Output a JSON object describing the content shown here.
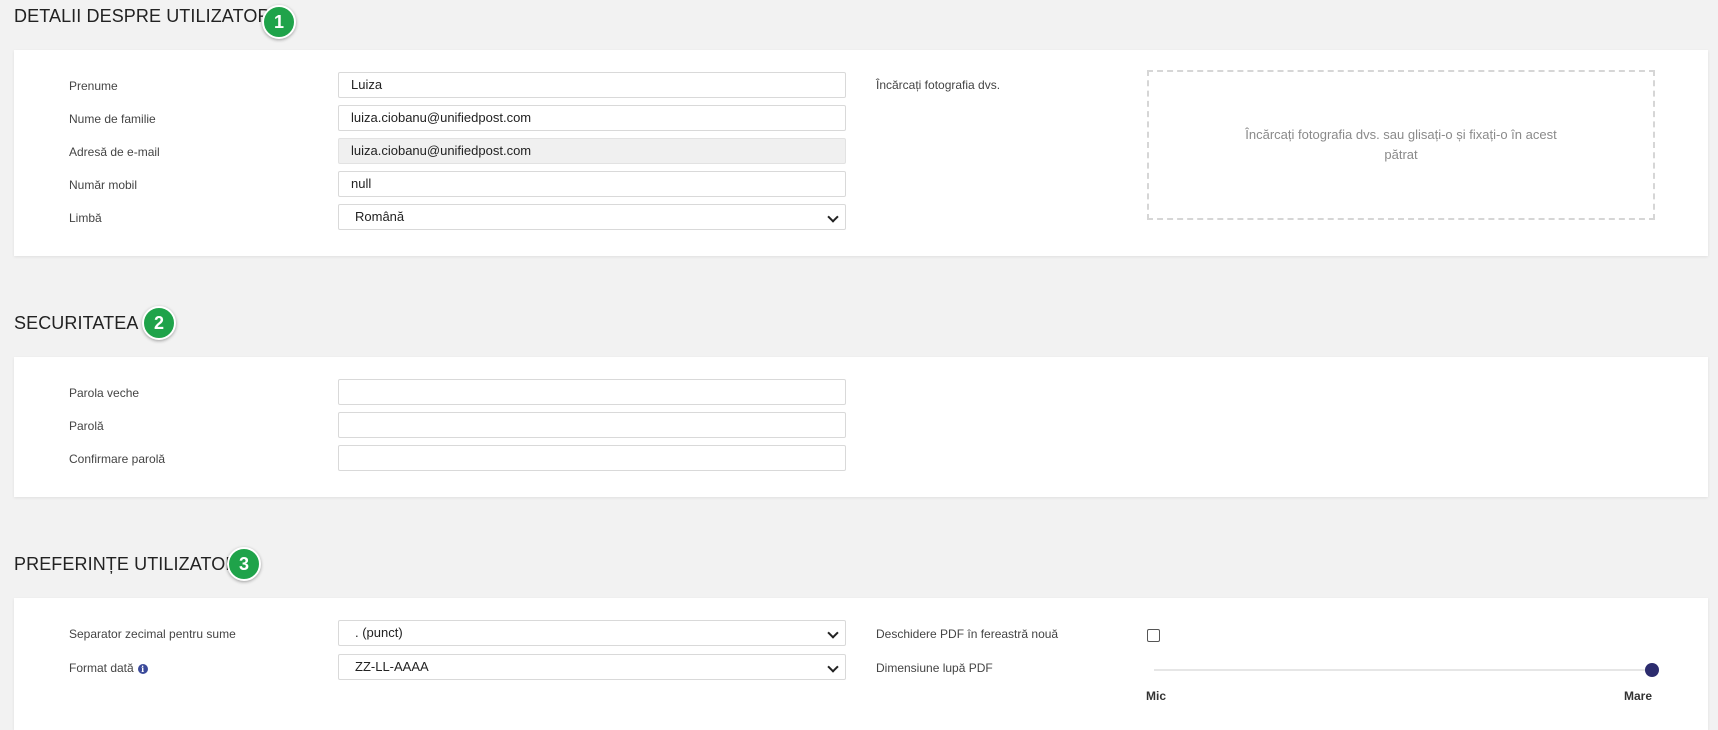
{
  "user_details": {
    "title": "DETALII DESPRE UTILIZATOR",
    "step": "1",
    "fields": {
      "first_name": {
        "label": "Prenume",
        "value": "Luiza"
      },
      "last_name": {
        "label": "Nume de familie",
        "value": "luiza.ciobanu@unifiedpost.com"
      },
      "email": {
        "label": "Adresă de e-mail",
        "value": "luiza.ciobanu@unifiedpost.com"
      },
      "mobile": {
        "label": "Număr mobil",
        "value": "null"
      },
      "language": {
        "label": "Limbă",
        "value": "Română"
      }
    },
    "photo": {
      "label": "Încărcați fotografia dvs.",
      "dropzone_text": "Încărcați fotografia dvs. sau glisați-o și fixați-o în acest pătrat"
    }
  },
  "security": {
    "title": "SECURITATEA",
    "step": "2",
    "fields": {
      "old_password": {
        "label": "Parola veche",
        "value": ""
      },
      "password": {
        "label": "Parolă",
        "value": ""
      },
      "confirm_password": {
        "label": "Confirmare parolă",
        "value": ""
      }
    }
  },
  "preferences": {
    "title": "PREFERINȚE UTILIZATOR",
    "step": "3",
    "decimal_separator": {
      "label": "Separator zecimal pentru sume",
      "value": ". (punct)"
    },
    "date_format": {
      "label": "Format dată",
      "value": "ZZ-LL-AAAA",
      "info_icon": "i"
    },
    "open_pdf_new_window": {
      "label": "Deschidere PDF în fereastră nouă",
      "checked": false
    },
    "pdf_magnifier": {
      "label": "Dimensiune lupă PDF",
      "min_label": "Mic",
      "max_label": "Mare",
      "level": 1.0
    }
  },
  "colors": {
    "accent_green": "#1fa34a",
    "slider_thumb": "#2c2c6e",
    "info_icon": "#3b4a9a"
  }
}
